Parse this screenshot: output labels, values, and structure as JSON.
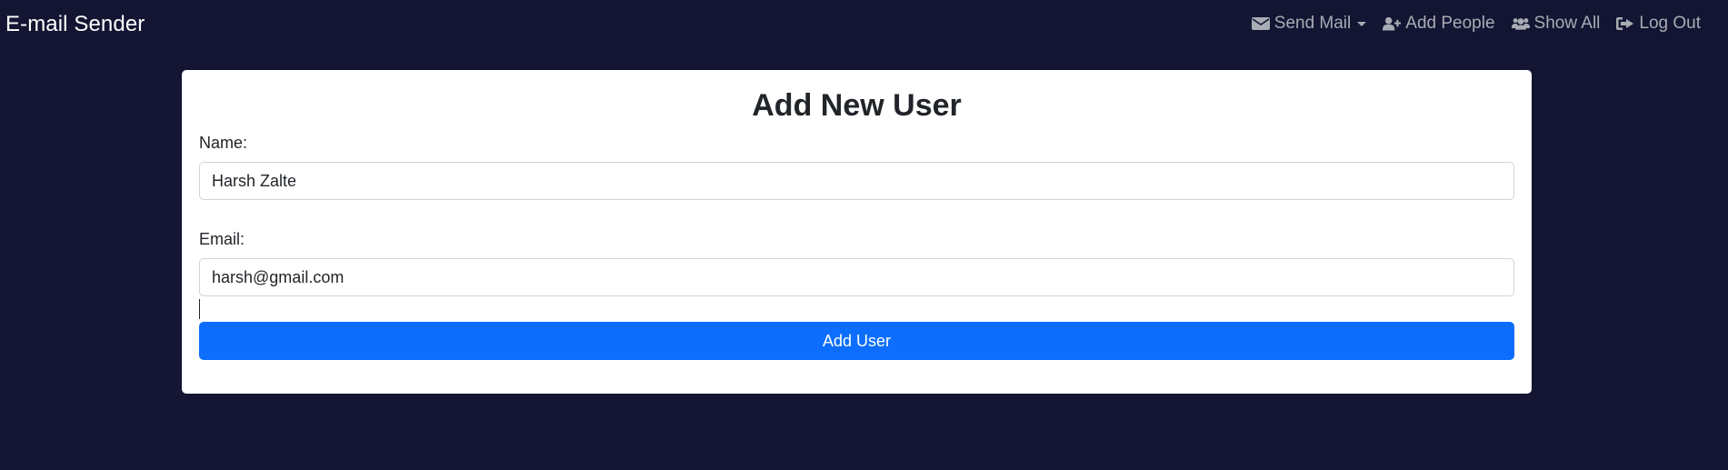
{
  "navbar": {
    "brand": "E-mail Sender",
    "items": [
      {
        "label": "Send Mail",
        "icon": "envelope-icon",
        "dropdown": true
      },
      {
        "label": "Add People",
        "icon": "user-plus-icon"
      },
      {
        "label": "Show All",
        "icon": "users-icon"
      },
      {
        "label": "Log Out",
        "icon": "sign-out-icon"
      }
    ]
  },
  "form": {
    "title": "Add New User",
    "name_label": "Name:",
    "name_value": "Harsh Zalte",
    "email_label": "Email:",
    "email_value": "harsh@gmail.com",
    "submit_label": "Add User"
  },
  "colors": {
    "background": "#131533",
    "nav_text": "#a8acb3",
    "primary": "#0d6efd"
  }
}
